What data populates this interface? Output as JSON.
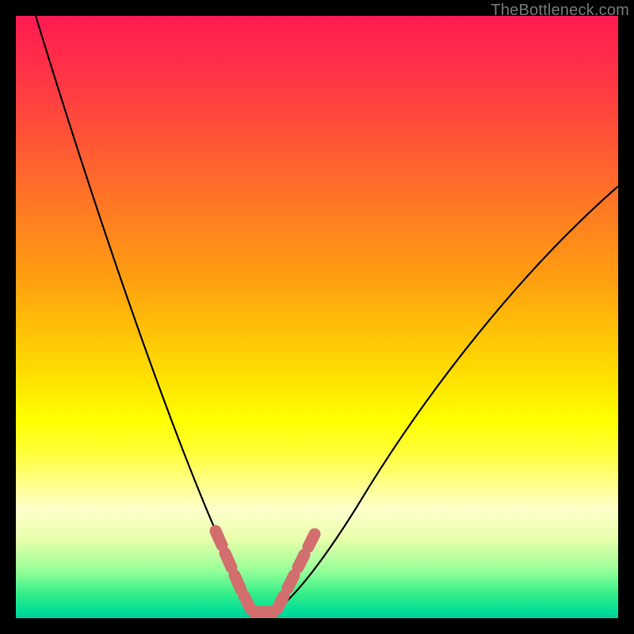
{
  "watermark": "TheBottleneck.com",
  "colors": {
    "background": "#000000",
    "curve": "#000000",
    "marker": "#d26e6e",
    "gradient_stops": [
      "#ff1a50",
      "#ff2a4a",
      "#ff4040",
      "#ff6030",
      "#ff8020",
      "#ffa010",
      "#ffc008",
      "#ffe000",
      "#ffff00",
      "#ffff33",
      "#ffff80",
      "#ffffcc",
      "#e6ffaa",
      "#99ff99",
      "#33ee88",
      "#00dd99",
      "#00cc99"
    ]
  },
  "chart_data": {
    "type": "line",
    "title": "",
    "xlabel": "",
    "ylabel": "",
    "xlim": [
      0,
      100
    ],
    "ylim": [
      0,
      100
    ],
    "x": [
      0,
      5,
      10,
      15,
      20,
      25,
      30,
      32,
      34,
      36,
      38,
      40,
      42,
      45,
      50,
      55,
      60,
      65,
      70,
      75,
      80,
      85,
      90,
      95,
      100
    ],
    "values": [
      100,
      88,
      76,
      64,
      52,
      40,
      28,
      20,
      12,
      5,
      1,
      0,
      0,
      1,
      5,
      12,
      20,
      28,
      36,
      44,
      51,
      57,
      62,
      66,
      70
    ],
    "optimal_range_x": [
      34,
      46
    ],
    "markers": [
      {
        "x": 34.0,
        "y": 11
      },
      {
        "x": 35.5,
        "y": 6
      },
      {
        "x": 37.0,
        "y": 2
      },
      {
        "x": 38.5,
        "y": 0.5
      },
      {
        "x": 40.0,
        "y": 0
      },
      {
        "x": 41.5,
        "y": 0
      },
      {
        "x": 43.0,
        "y": 0.5
      },
      {
        "x": 44.5,
        "y": 2.5
      },
      {
        "x": 46.0,
        "y": 6
      },
      {
        "x": 47.5,
        "y": 10
      }
    ]
  }
}
